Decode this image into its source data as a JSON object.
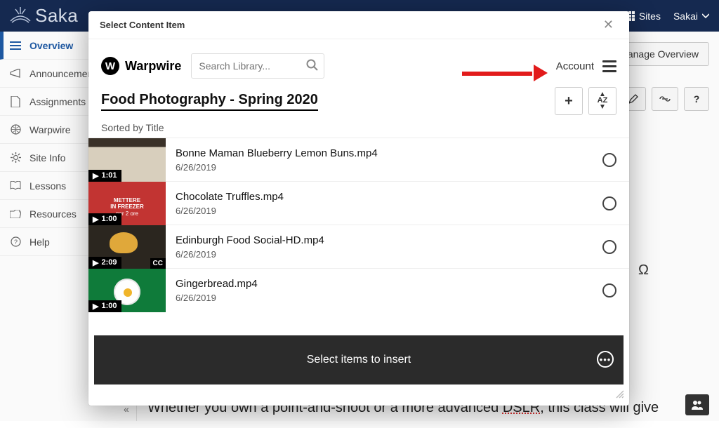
{
  "topbar": {
    "brand": "Saka",
    "sites_label": "Sites",
    "profile_label": "Sakai"
  },
  "sidebar": {
    "items": [
      {
        "label": "Overview",
        "active": true,
        "icon": "list-icon"
      },
      {
        "label": "Announcements",
        "icon": "bullhorn-icon"
      },
      {
        "label": "Assignments",
        "icon": "file-icon"
      },
      {
        "label": "Warpwire",
        "icon": "globe-icon"
      },
      {
        "label": "Site Info",
        "icon": "gear-icon"
      },
      {
        "label": "Lessons",
        "icon": "book-icon"
      },
      {
        "label": "Resources",
        "icon": "folder-open-icon"
      },
      {
        "label": "Help",
        "icon": "question-circle-icon"
      }
    ]
  },
  "toolbar": {
    "manage_label": "Manage Overview"
  },
  "modal": {
    "title": "Select Content Item",
    "ww_brand": "Warpwire",
    "search_placeholder": "Search Library...",
    "account_label": "Account",
    "library_title": "Food Photography - Spring 2020",
    "sorted_text": "Sorted by Title",
    "footer_text": "Select items to insert"
  },
  "items": [
    {
      "title": "Bonne Maman Blueberry Lemon Buns.mp4",
      "date": "6/26/2019",
      "duration": "1:01",
      "thumb_class": "brown",
      "cc": false
    },
    {
      "title": "Chocolate Truffles.mp4",
      "date": "6/26/2019",
      "duration": "1:00",
      "thumb_class": "red",
      "thumb_text1": "METTERE",
      "thumb_text2": "IN FREEZER",
      "thumb_text3": "per 2 ore",
      "cc": false
    },
    {
      "title": "Edinburgh Food Social-HD.mp4",
      "date": "6/26/2019",
      "duration": "2:09",
      "thumb_class": "dark",
      "cc": true
    },
    {
      "title": "Gingerbread.mp4",
      "date": "6/26/2019",
      "duration": "1:00",
      "thumb_class": "green",
      "bowl": true,
      "cc": false
    }
  ],
  "bg": {
    "text_pre": "Whether you own a point-and-shoot or a more advanced ",
    "text_term": "DSLR",
    "text_post": ", this class will give"
  }
}
